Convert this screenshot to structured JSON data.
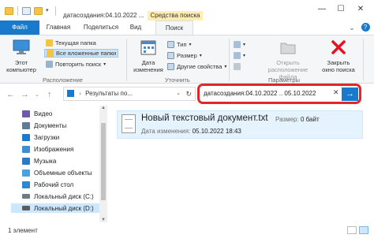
{
  "titlebar": {
    "title": "датасоздания:04.10.2022 ...",
    "context_tab": "Средства поиска",
    "minimize": "—",
    "maximize": "☐",
    "close": "✕"
  },
  "tabs": {
    "file": "Файл",
    "home": "Главная",
    "share": "Поделиться",
    "view": "Вид",
    "search": "Поиск"
  },
  "ribbon": {
    "this_pc": "Этот\nкомпьютер",
    "current_folder": "Текущая папка",
    "all_subfolders": "Все вложенные папки",
    "search_again": "Повторить поиск",
    "location_label": "Расположение",
    "date_modified": "Дата\nизменения",
    "type": "Тип",
    "size": "Размер",
    "other_properties": "Другие свойства",
    "refine_label": "Уточнить",
    "recent_searches": "Последние поиски",
    "advanced_options": "Дополнительные параметры",
    "save_search": "Сохранить условия поиска",
    "open_location": "Открыть\nрасположение файла",
    "close_search": "Закрыть\nокно поиска",
    "options_label": "Параметры"
  },
  "address": {
    "path": "Результаты по...",
    "search_query": "датасоздания:04.10.2022 .. 05.10.2022"
  },
  "nav": {
    "items": [
      {
        "label": "Видео",
        "color": "#6e5aa8"
      },
      {
        "label": "Документы",
        "color": "#5f7b96"
      },
      {
        "label": "Загрузки",
        "color": "#1f79c9"
      },
      {
        "label": "Изображения",
        "color": "#3a8fd6"
      },
      {
        "label": "Музыка",
        "color": "#2c7ac4"
      },
      {
        "label": "Объемные объекты",
        "color": "#4aa3df"
      },
      {
        "label": "Рабочий стол",
        "color": "#2f87d3"
      },
      {
        "label": "Локальный диск (C:)",
        "color": "#707a86"
      },
      {
        "label": "Локальный диск (D:)",
        "color": "#5c5c5c"
      }
    ]
  },
  "file": {
    "name": "Новый текстовый документ.txt",
    "date_label": "Дата изменения:",
    "date_value": "05.10.2022 18:43",
    "size_label": "Размер:",
    "size_value": "0 байт"
  },
  "status": {
    "count": "1 элемент"
  },
  "colors": {
    "accent": "#1979ca",
    "context_tab": "#ffeeb0",
    "highlight_outline": "#e0282b",
    "selection": "#cce8ff"
  }
}
